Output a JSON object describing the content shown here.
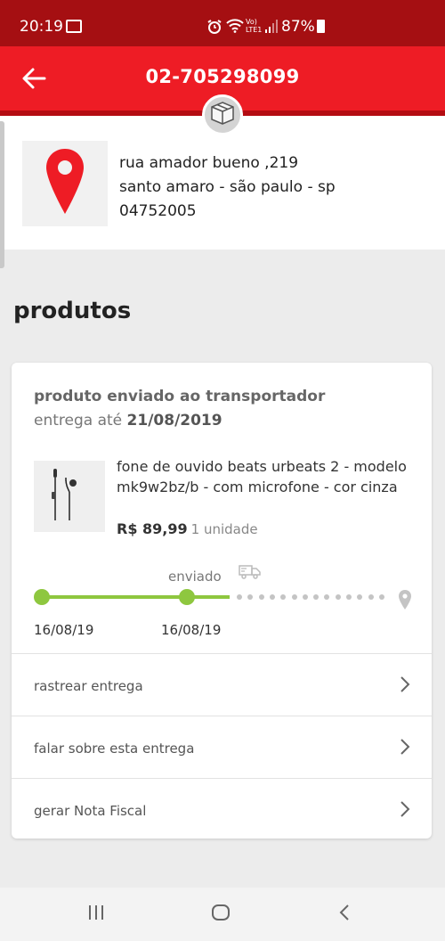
{
  "status_bar": {
    "time": "20:19",
    "battery": "87%"
  },
  "app_bar": {
    "title": "02-705298099"
  },
  "address": {
    "line1": "rua amador bueno ,219",
    "line2": "santo amaro - são paulo - sp",
    "line3": "04752005"
  },
  "section_title": "produtos",
  "order": {
    "status": "produto enviado ao transportador",
    "deadline_prefix": "entrega até",
    "deadline_date": "21/08/2019",
    "product": {
      "name": "fone de ouvido beats urbeats 2 - modelo mk9w2bz/b - com microfone - cor cinza",
      "price": "R$ 89,99",
      "quantity": "1 unidade"
    },
    "tracking": {
      "stage_label": "enviado",
      "date_start": "16/08/19",
      "date_sent": "16/08/19"
    },
    "actions": [
      {
        "label": "rastrear entrega"
      },
      {
        "label": "falar sobre esta entrega"
      },
      {
        "label": "gerar Nota Fiscal"
      }
    ]
  },
  "colors": {
    "brand_red": "#ee1c25",
    "status_bar_red": "#a50f12",
    "progress_green": "#8ec73f"
  }
}
